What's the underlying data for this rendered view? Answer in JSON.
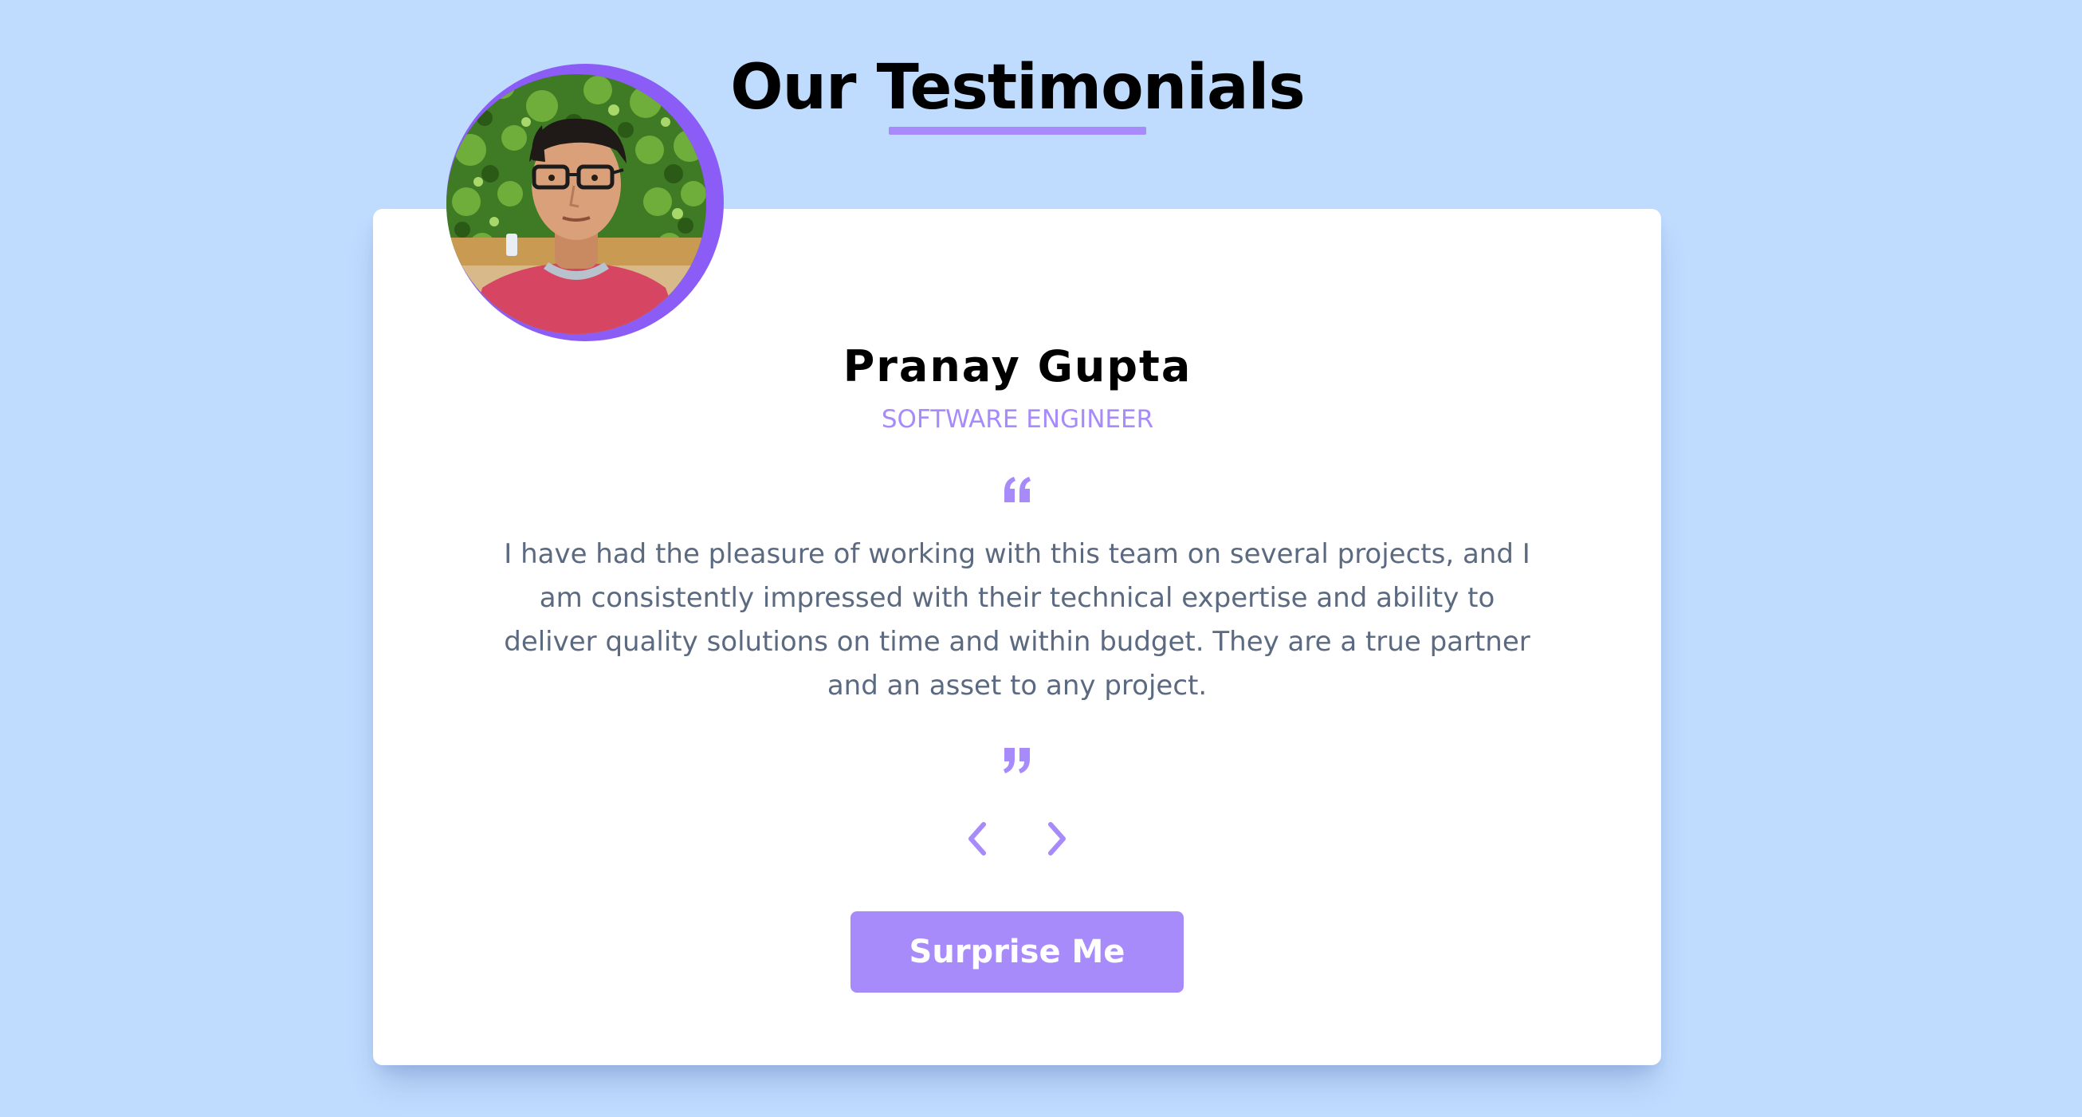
{
  "header": {
    "title": "Our Testimonials"
  },
  "testimonial": {
    "name": "Pranay Gupta",
    "role": "SOFTWARE ENGINEER",
    "text": "I have had the pleasure of working with this team on several projects, and I am consistently impressed with their technical expertise and ability to deliver quality solutions on time and within budget. They are a true partner and an asset to any project."
  },
  "controls": {
    "prev_icon": "chevron-left-icon",
    "next_icon": "chevron-right-icon",
    "surprise_label": "Surprise Me"
  },
  "colors": {
    "background": "#bfdbfe",
    "accent": "#a78bfa",
    "ring": "#8b5cf6",
    "text_muted": "#5b6a80",
    "card": "#ffffff"
  }
}
